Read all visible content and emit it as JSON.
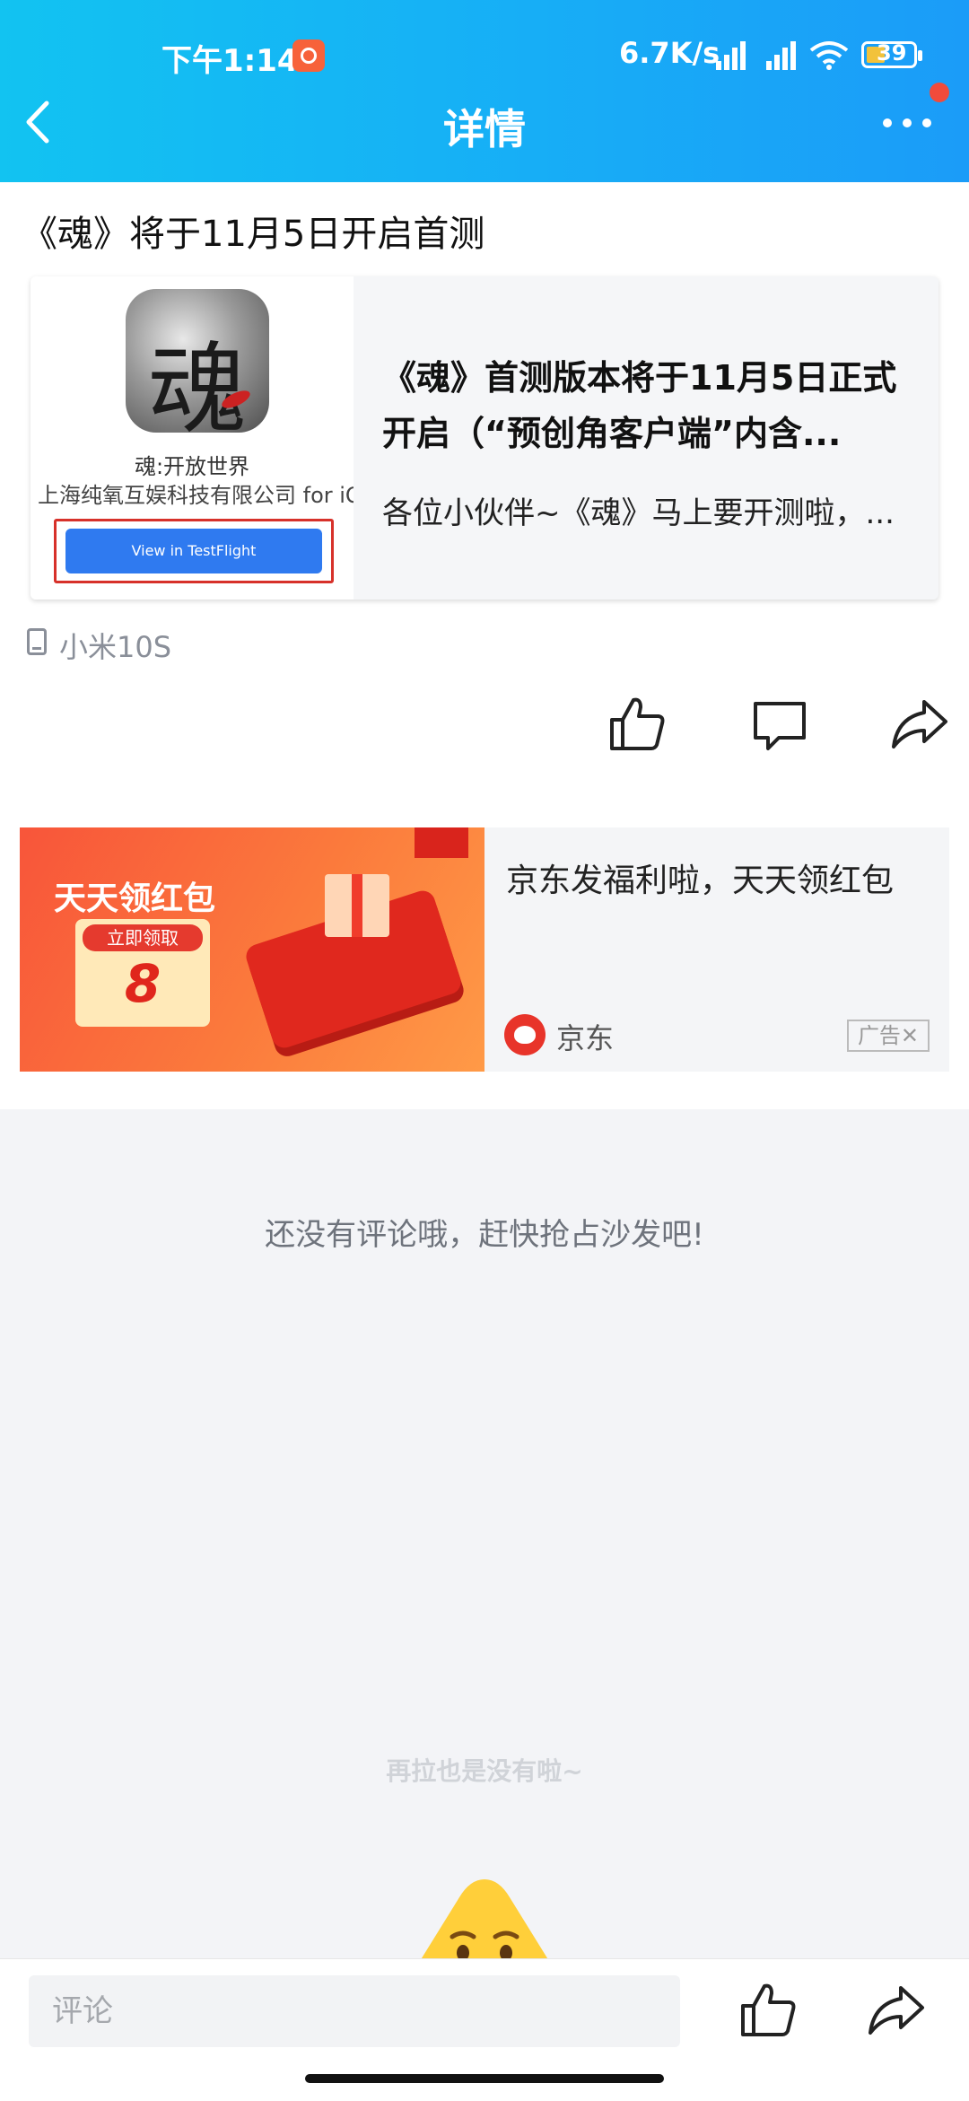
{
  "status_bar": {
    "time": "下午1:14",
    "net_speed": "6.7K/s",
    "battery": "39"
  },
  "header": {
    "title": "详情"
  },
  "post": {
    "title": "《魂》将于11月5日开启首测",
    "share": {
      "app_name": "魂:开放世界",
      "company": "上海纯氧互娱科技有限公司 for iOS",
      "button_label": "View in TestFlight",
      "headline": "《魂》首测版本将于11月5日正式开启（“预创角客户端”内含...",
      "summary": "各位小伙伴~《魂》马上要开测啦，..."
    },
    "device": "小米10S"
  },
  "ad": {
    "banner_title": "天天领红包",
    "coupon_label": "立即领取",
    "coupon_value": "8",
    "title": "京东发福利啦，天天领红包",
    "brand": "京东",
    "tag": "广告✕"
  },
  "comments": {
    "empty_message": "还没有评论哦，赶快抢占沙发吧!",
    "end_message": "再拉也是没有啦~"
  },
  "bottom_bar": {
    "comment_placeholder": "评论"
  },
  "colors": {
    "header": "#17aef6",
    "accent_red": "#f14b3b",
    "testflight_blue": "#2f7af0"
  },
  "icons": [
    "back-arrow-icon",
    "more-dots-icon",
    "device-icon",
    "like-icon",
    "comment-icon",
    "share-icon",
    "jd-logo-icon",
    "mascot-icon"
  ]
}
